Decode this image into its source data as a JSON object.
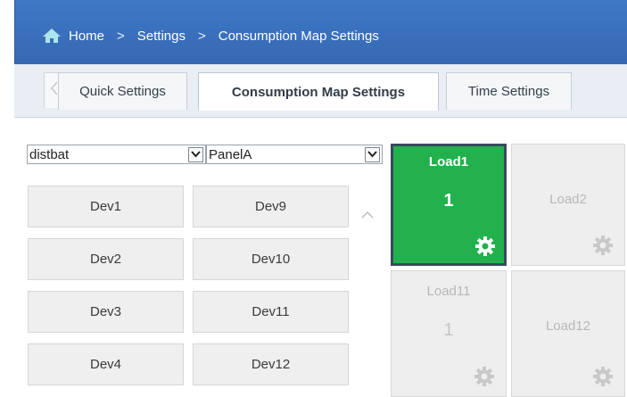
{
  "breadcrumb": {
    "home_icon": "home-icon",
    "items": [
      "Home",
      "Settings",
      "Consumption Map Settings"
    ],
    "separator": ">"
  },
  "tabs": {
    "prev_icon": "chevron-left-icon",
    "items": [
      {
        "label": "Quick Settings",
        "active": false
      },
      {
        "label": "Consumption Map Settings",
        "active": true
      },
      {
        "label": "Time Settings",
        "active": false
      }
    ]
  },
  "filters": {
    "group_select": {
      "value": "distbat"
    },
    "panel_select": {
      "value": "PanelA"
    }
  },
  "devices": {
    "column1": [
      "Dev1",
      "Dev2",
      "Dev3",
      "Dev4"
    ],
    "column2": [
      "Dev9",
      "Dev10",
      "Dev11",
      "Dev12"
    ],
    "scroll_icon": "chevron-up-icon"
  },
  "loads": [
    {
      "name": "Load1",
      "count": "1",
      "active": true,
      "icon": "gear-icon"
    },
    {
      "name": "Load2",
      "count": "",
      "active": false,
      "icon": "gear-icon"
    },
    {
      "name": "Load11",
      "count": "1",
      "active": false,
      "icon": "gear-icon"
    },
    {
      "name": "Load12",
      "count": "",
      "active": false,
      "icon": "gear-icon"
    }
  ],
  "colors": {
    "header_blue": "#3569b4",
    "active_load_green": "#22b14c",
    "inactive_tile": "#eeeeee"
  }
}
